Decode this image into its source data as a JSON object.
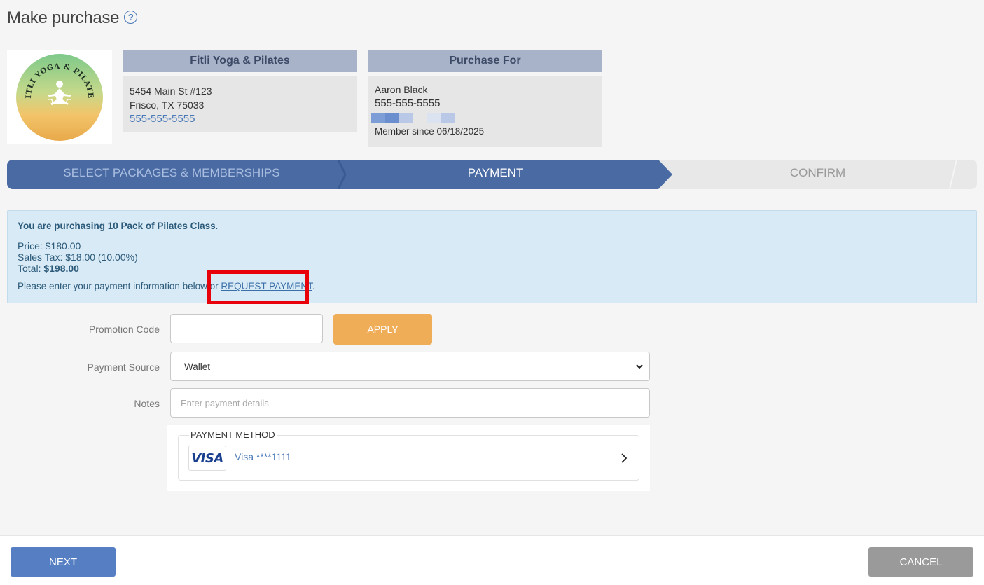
{
  "page": {
    "title": "Make purchase",
    "help_icon": "question-circle-icon"
  },
  "logo": {
    "text": "FITLI YOGA & PILATES"
  },
  "studio": {
    "name": "Fitli Yoga & Pilates",
    "address_line1": "5454 Main St #123",
    "address_line2": "Frisco, TX 75033",
    "phone": "555-555-5555"
  },
  "purchase_for": {
    "header": "Purchase For",
    "name": "Aaron Black",
    "phone": "555-555-5555",
    "member_since": "Member since 06/18/2025"
  },
  "steps": [
    {
      "label": "SELECT PACKAGES & MEMBERSHIPS",
      "state": "done"
    },
    {
      "label": "PAYMENT",
      "state": "active"
    },
    {
      "label": "CONFIRM",
      "state": "pending"
    }
  ],
  "summary": {
    "purchasing_text": "You are purchasing 10 Pack of Pilates Class",
    "purchasing_suffix": ".",
    "price": "Price: $180.00",
    "sales_tax": "Sales Tax: $18.00 (10.00%)",
    "total_label": "Total: ",
    "total_value": "$198.00",
    "enter_text": "Please enter your payment information below or ",
    "request_link": "REQUEST PAYMENT",
    "enter_suffix": "."
  },
  "form": {
    "promotion_label": "Promotion Code",
    "promotion_value": "",
    "apply_label": "APPLY",
    "payment_source_label": "Payment Source",
    "payment_source_value": "Wallet",
    "notes_label": "Notes",
    "notes_placeholder": "Enter payment details"
  },
  "payment_method": {
    "legend": "PAYMENT METHOD",
    "card_brand": "VISA",
    "card_label": "Visa ****1111"
  },
  "footer": {
    "next_label": "NEXT",
    "cancel_label": "CANCEL"
  },
  "colors": {
    "primary": "#4a6aa3",
    "accent_orange": "#f0ad58",
    "info_bg": "#d8eaf5",
    "highlight": "#e8000b"
  }
}
